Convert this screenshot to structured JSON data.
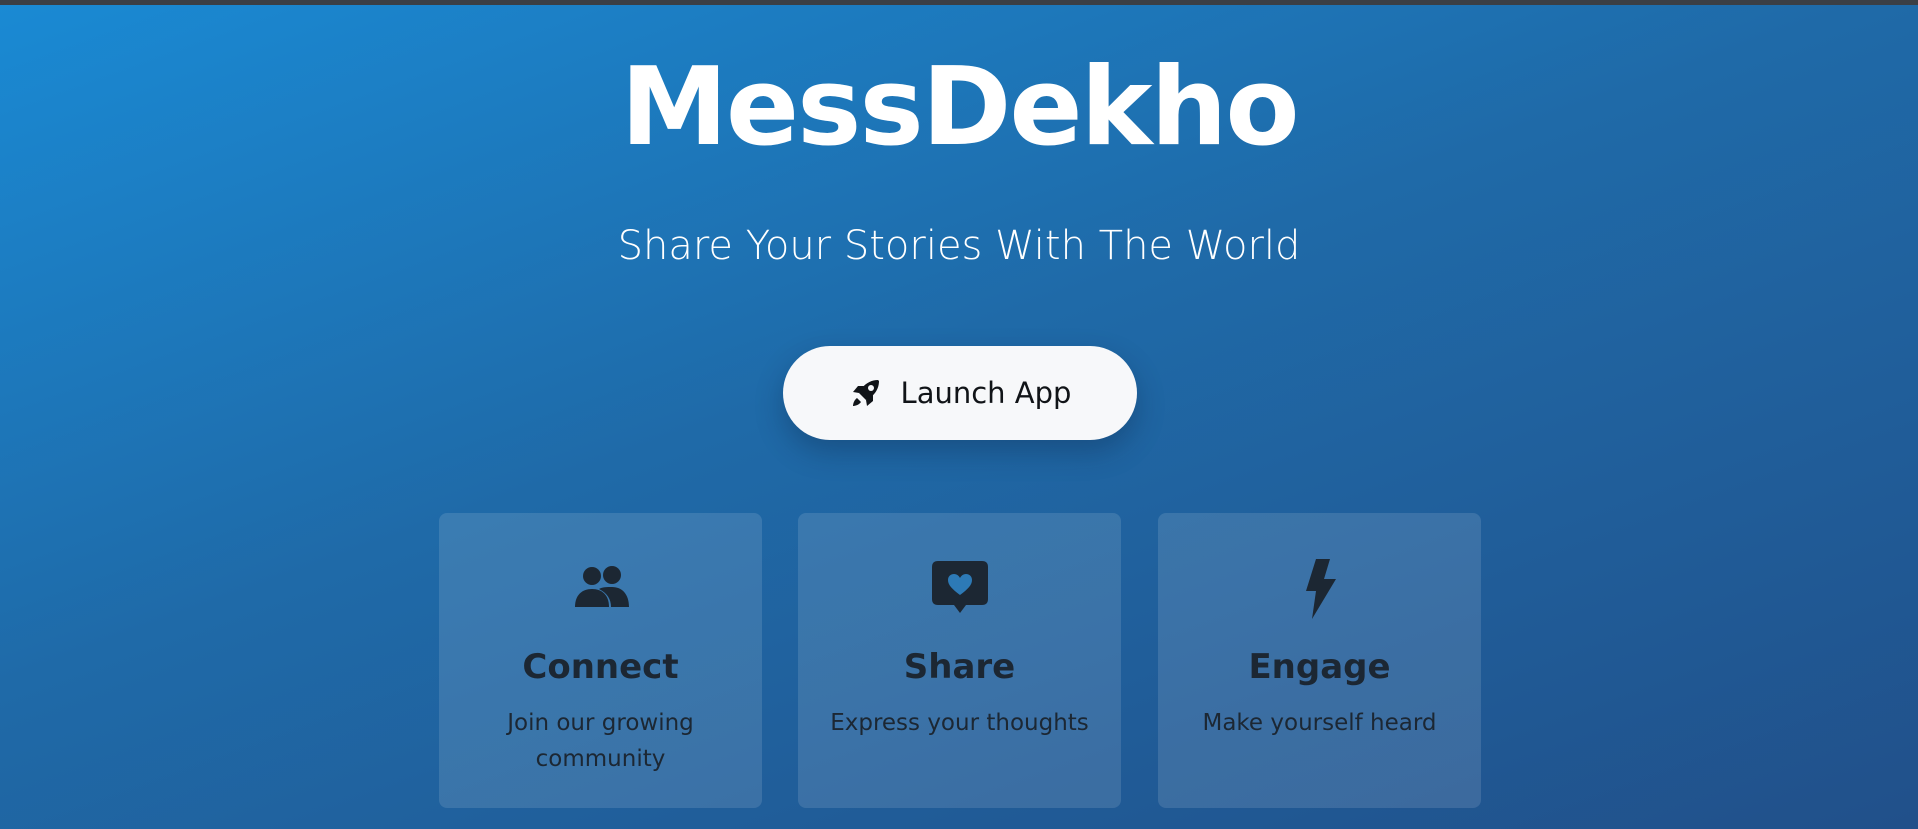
{
  "hero": {
    "title": "MessDekho",
    "subtitle": "Share Your Stories With The World"
  },
  "launch_button": {
    "label": "Launch App",
    "icon": "rocket-icon"
  },
  "features": [
    {
      "icon": "users-icon",
      "title": "Connect",
      "description": "Join our growing community"
    },
    {
      "icon": "heart-message-icon",
      "title": "Share",
      "description": "Express your thoughts"
    },
    {
      "icon": "lightning-icon",
      "title": "Engage",
      "description": "Make yourself heard"
    }
  ],
  "colors": {
    "background_start": "#1a8ad4",
    "background_end": "#21508a",
    "button_bg": "#f7f8fa",
    "card_text": "#1c2733"
  }
}
